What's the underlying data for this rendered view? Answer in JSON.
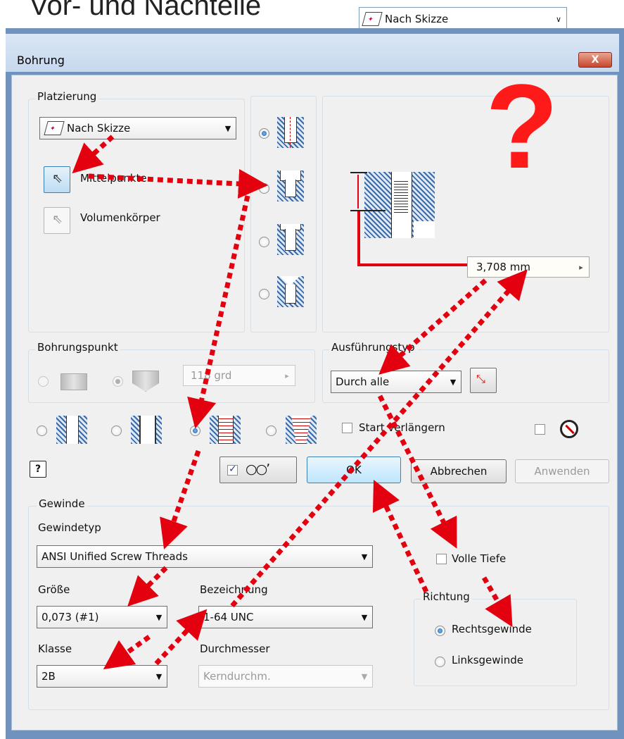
{
  "slide": {
    "title": "Vor- und Nachteile"
  },
  "top_combo": {
    "value": "Nach Skizze"
  },
  "dialog": {
    "title": "Bohrung",
    "close_label": "X",
    "placement": {
      "group_label": "Platzierung",
      "combo_value": "Nach Skizze",
      "options": [
        {
          "label": "Mittelpunkte",
          "active": true
        },
        {
          "label": "Volumenkörper",
          "active": false
        }
      ]
    },
    "preview": {
      "depth_value": "3,708 mm"
    },
    "drill_point": {
      "group_label": "Bohrungspunkt",
      "angle_value": "118 grd"
    },
    "termination": {
      "group_label": "Ausführungstyp",
      "combo_value": "Durch alle"
    },
    "extend_start_label": "Start verlängern",
    "buttons": {
      "help": "?",
      "ok": "OK",
      "cancel": "Abbrechen",
      "apply": "Anwenden"
    },
    "thread": {
      "group_label": "Gewinde",
      "type_label": "Gewindetyp",
      "type_value": "ANSI Unified Screw Threads",
      "size_label": "Größe",
      "size_value": "0,073 (#1)",
      "designation_label": "Bezeichnung",
      "designation_value": "1-64 UNC",
      "class_label": "Klasse",
      "class_value": "2B",
      "diameter_label": "Durchmesser",
      "diameter_value": "Kerndurchm.",
      "full_depth_label": "Volle Tiefe",
      "direction": {
        "group_label": "Richtung",
        "right": "Rechtsgewinde",
        "left": "Linksgewinde"
      }
    }
  },
  "annotation": {
    "question_mark": "?",
    "arrow_color": "#e3000f"
  }
}
